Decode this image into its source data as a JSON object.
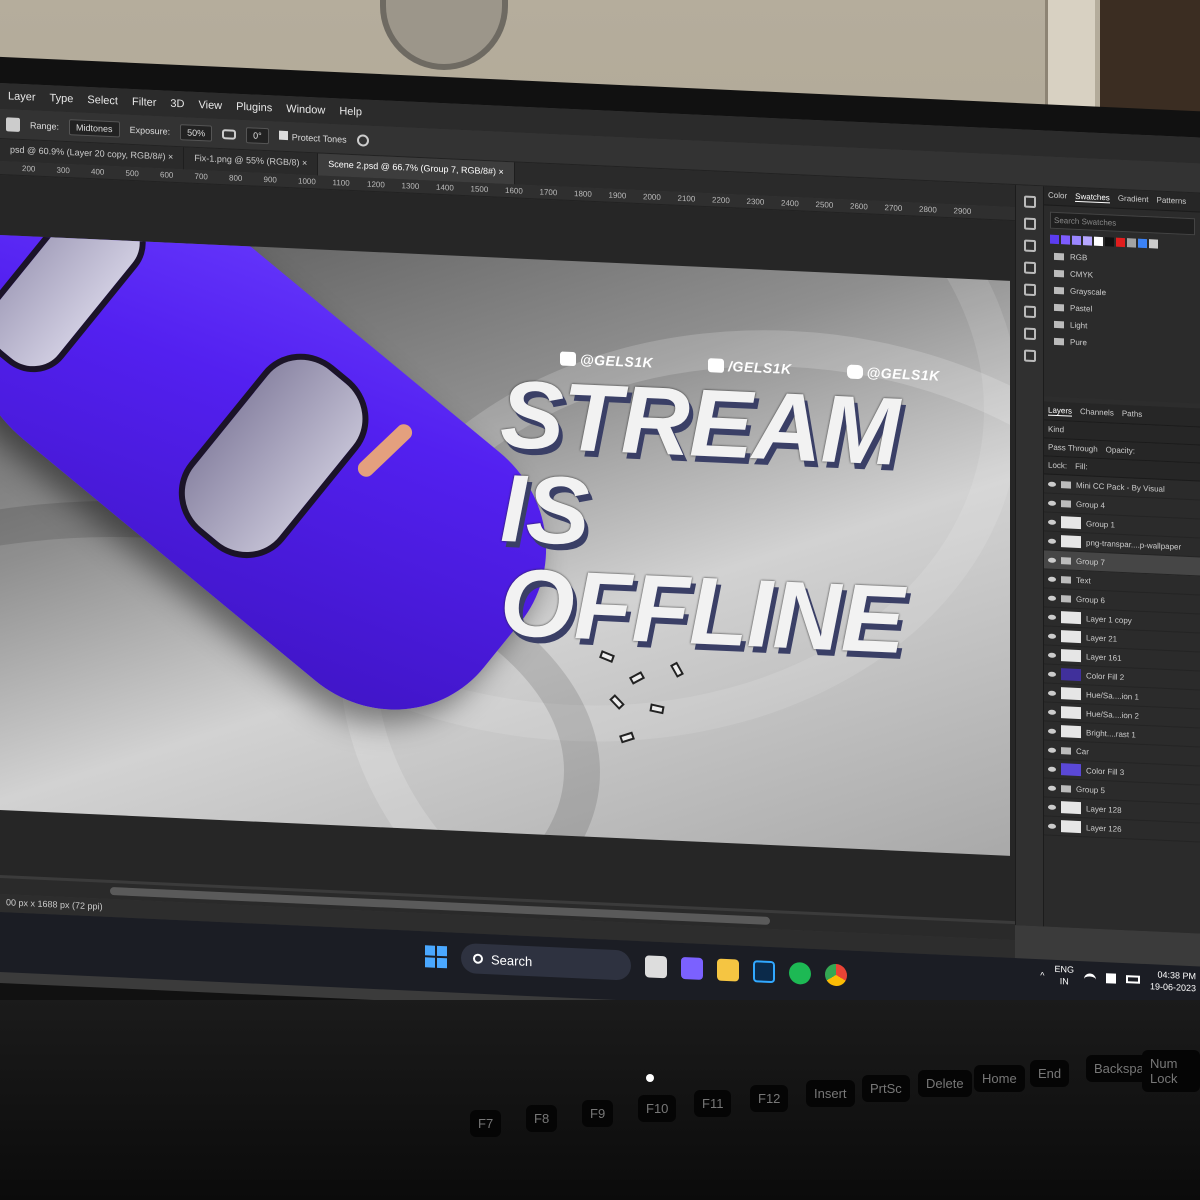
{
  "menu": [
    "Layer",
    "Type",
    "Select",
    "Filter",
    "3D",
    "View",
    "Plugins",
    "Window",
    "Help"
  ],
  "options": {
    "range_label": "Range:",
    "range_value": "Midtones",
    "exposure_label": "Exposure:",
    "exposure_value": "50%",
    "angle_value": "0°",
    "protect_tones": "Protect Tones"
  },
  "tabs": [
    {
      "label": "psd @ 60.9% (Layer 20 copy, RGB/8#)",
      "active": false
    },
    {
      "label": "Fix-1.png @ 55% (RGB/8)",
      "active": false
    },
    {
      "label": "Scene 2.psd @ 66.7% (Group 7, RGB/8#)",
      "active": true
    }
  ],
  "ruler": [
    "200",
    "300",
    "400",
    "500",
    "600",
    "700",
    "800",
    "900",
    "1000",
    "1100",
    "1200",
    "1300",
    "1400",
    "1500",
    "1600",
    "1700",
    "1800",
    "1900",
    "2000",
    "2100",
    "2200",
    "2300",
    "2400",
    "2500",
    "2600",
    "2700",
    "2800",
    "2900"
  ],
  "artwork": {
    "socials": [
      "@GELS1K",
      "/GELS1K",
      "@GELS1K"
    ],
    "line1": "STREAM IS",
    "line2": "OFFLINE"
  },
  "swatches_panel": {
    "tabs": [
      "Color",
      "Swatches",
      "Gradient",
      "Patterns"
    ],
    "search_placeholder": "Search Swatches",
    "colors": [
      "#5b3cf0",
      "#7d5cff",
      "#9a86ff",
      "#b6a7ff",
      "#ffffff",
      "#111111",
      "#e11d1d",
      "#a3a3a3",
      "#3b82f6",
      "#cccccc"
    ],
    "folders": [
      "RGB",
      "CMYK",
      "Grayscale",
      "Pastel",
      "Light",
      "Pure"
    ]
  },
  "layers_panel": {
    "tabs": [
      "Layers",
      "Channels",
      "Paths"
    ],
    "filter": "Kind",
    "blend_mode": "Pass Through",
    "opacity_label": "Opacity:",
    "lock_label": "Lock:",
    "fill_label": "Fill:",
    "layers": [
      {
        "name": "Mini CC Pack - By Visual",
        "kind": "group",
        "thumb": "plain"
      },
      {
        "name": "Group 4",
        "kind": "group",
        "thumb": "plain"
      },
      {
        "name": "Group 1",
        "kind": "layer",
        "thumb": "plain"
      },
      {
        "name": "png-transpar....p-wallpaper",
        "kind": "layer",
        "thumb": "plain"
      },
      {
        "name": "Group 7",
        "kind": "group",
        "thumb": "plain",
        "selected": true
      },
      {
        "name": "Text",
        "kind": "group",
        "thumb": "plain"
      },
      {
        "name": "Group 6",
        "kind": "group",
        "thumb": "plain"
      },
      {
        "name": "Layer 1 copy",
        "kind": "layer",
        "thumb": "plain"
      },
      {
        "name": "Layer 21",
        "kind": "layer",
        "thumb": "plain"
      },
      {
        "name": "Layer 161",
        "kind": "layer",
        "thumb": "plain"
      },
      {
        "name": "Color Fill 2",
        "kind": "layer",
        "thumb": "fill"
      },
      {
        "name": "Hue/Sa....ion 1",
        "kind": "layer",
        "thumb": "plain"
      },
      {
        "name": "Hue/Sa....ion 2",
        "kind": "layer",
        "thumb": "plain"
      },
      {
        "name": "Bright....rast 1",
        "kind": "layer",
        "thumb": "plain"
      },
      {
        "name": "Car",
        "kind": "group",
        "thumb": "plain"
      },
      {
        "name": "Color Fill 3",
        "kind": "layer",
        "thumb": "fill2"
      },
      {
        "name": "Group 5",
        "kind": "group",
        "thumb": "plain"
      },
      {
        "name": "Layer 128",
        "kind": "layer",
        "thumb": "plain"
      },
      {
        "name": "Layer 126",
        "kind": "layer",
        "thumb": "plain"
      }
    ]
  },
  "status": {
    "doc_size": "00 px x 1688 px (72 ppi)"
  },
  "taskbar": {
    "search_label": "Search",
    "lang_top": "ENG",
    "lang_bottom": "IN",
    "time": "04:38 PM",
    "date": "19-06-2023"
  },
  "keyboard": {
    "keys": [
      "F7",
      "F8",
      "F9",
      "F10",
      "F11",
      "F12",
      "Insert",
      "PrtSc",
      "Delete",
      "Home",
      "End",
      "Backspace",
      "Num Lock"
    ]
  }
}
